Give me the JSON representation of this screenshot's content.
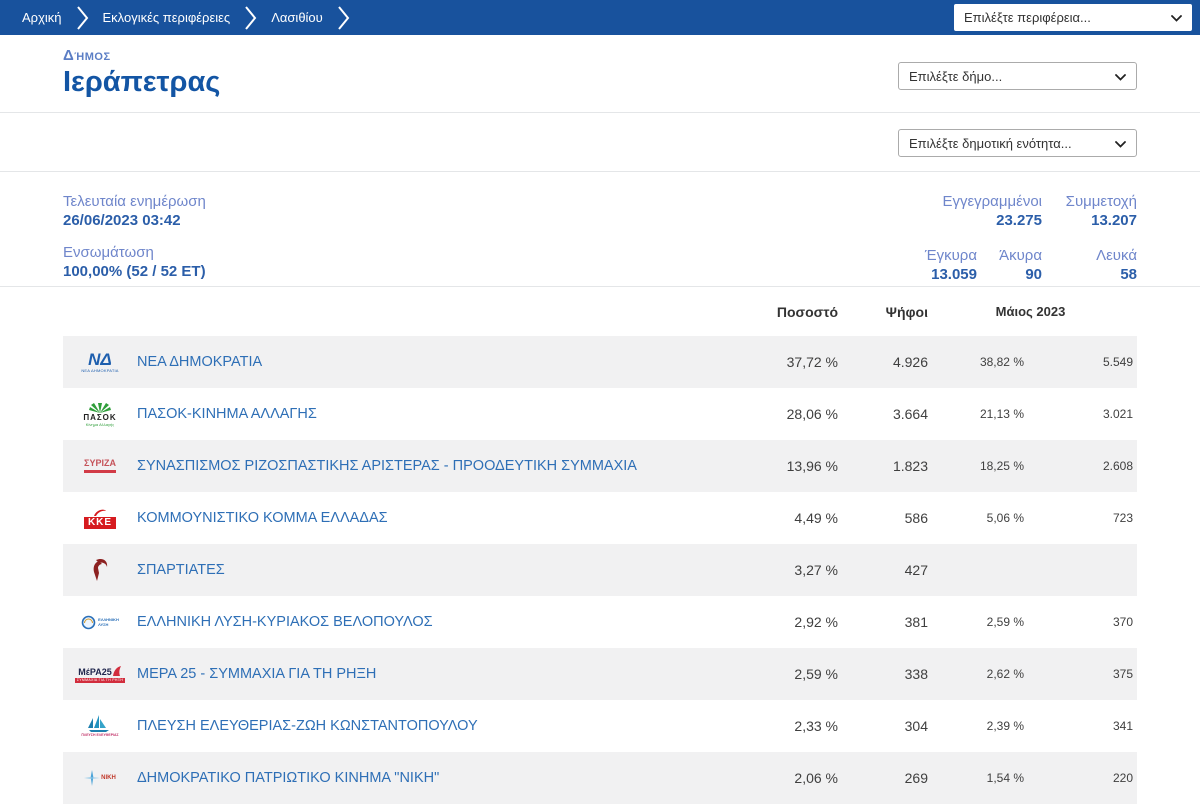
{
  "breadcrumb": {
    "items": [
      "Αρχική",
      "Εκλογικές περιφέρειες",
      "Λασιθίου"
    ]
  },
  "region_select": {
    "value": "Επιλέξτε περιφέρεια..."
  },
  "municipality_select": {
    "value": "Επιλέξτε δήμο..."
  },
  "unit_select": {
    "value": "Επιλέξτε δημοτική ενότητα..."
  },
  "page": {
    "subtitle": "Δήμος",
    "title": "Ιεράπετρας"
  },
  "stats": {
    "last_update_label": "Τελευταία ενημέρωση",
    "last_update_value": "26/06/2023 03:42",
    "integration_label": "Ενσωμάτωση",
    "integration_value": "100,00% (52 / 52 ΕΤ)",
    "registered_label": "Εγγεγραμμένοι",
    "registered_value": "23.275",
    "turnout_label": "Συμμετοχή",
    "turnout_value": "13.207",
    "valid_label": "Έγκυρα",
    "valid_value": "13.059",
    "invalid_label": "Άκυρα",
    "invalid_value": "90",
    "blank_label": "Λευκά",
    "blank_value": "58"
  },
  "results_table": {
    "headers": {
      "percent": "Ποσοστό",
      "votes": "Ψήφοι",
      "previous": "Μάιος 2023"
    },
    "rows": [
      {
        "logo": "nea-dimokratia",
        "party": "ΝΕΑ ΔΗΜΟΚΡΑΤΙΑ",
        "percent": "37,72 %",
        "votes": "4.926",
        "prev_percent": "38,82 %",
        "prev_votes": "5.549"
      },
      {
        "logo": "pasok",
        "party": "ΠΑΣΟΚ-ΚΙΝΗΜΑ ΑΛΛΑΓΗΣ",
        "percent": "28,06 %",
        "votes": "3.664",
        "prev_percent": "21,13 %",
        "prev_votes": "3.021"
      },
      {
        "logo": "syriza",
        "party": "ΣΥΝΑΣΠΙΣΜΟΣ ΡΙΖΟΣΠΑΣΤΙΚΗΣ ΑΡΙΣΤΕΡΑΣ - ΠΡΟΟΔΕΥΤΙΚΗ ΣΥΜΜΑΧΙΑ",
        "percent": "13,96 %",
        "votes": "1.823",
        "prev_percent": "18,25 %",
        "prev_votes": "2.608"
      },
      {
        "logo": "kke",
        "party": "ΚΟΜΜΟΥΝΙΣΤΙΚΟ ΚΟΜΜΑ ΕΛΛΑΔΑΣ",
        "percent": "4,49 %",
        "votes": "586",
        "prev_percent": "5,06 %",
        "prev_votes": "723"
      },
      {
        "logo": "spartiates",
        "party": "ΣΠΑΡΤΙΑΤΕΣ",
        "percent": "3,27 %",
        "votes": "427",
        "prev_percent": "",
        "prev_votes": ""
      },
      {
        "logo": "elliniki-lysi",
        "party": "ΕΛΛΗΝΙΚΗ ΛΥΣΗ-ΚΥΡΙΑΚΟΣ ΒΕΛΟΠΟΥΛΟΣ",
        "percent": "2,92 %",
        "votes": "381",
        "prev_percent": "2,59 %",
        "prev_votes": "370"
      },
      {
        "logo": "mera25",
        "party": "ΜΕΡΑ 25 - ΣΥΜΜΑΧΙΑ ΓΙΑ ΤΗ ΡΗΞΗ",
        "percent": "2,59 %",
        "votes": "338",
        "prev_percent": "2,62 %",
        "prev_votes": "375"
      },
      {
        "logo": "plefsi-eleftherias",
        "party": "ΠΛΕΥΣΗ ΕΛΕΥΘΕΡΙΑΣ-ΖΩΗ ΚΩΝΣΤΑΝΤΟΠΟΥΛΟΥ",
        "percent": "2,33 %",
        "votes": "304",
        "prev_percent": "2,39 %",
        "prev_votes": "341"
      },
      {
        "logo": "niki",
        "party": "ΔΗΜΟΚΡΑΤΙΚΟ ΠΑΤΡΙΩΤΙΚΟ ΚΙΝΗΜΑ \"ΝΙΚΗ\"",
        "percent": "2,06 %",
        "votes": "269",
        "prev_percent": "1,54 %",
        "prev_votes": "220"
      }
    ]
  },
  "colors": {
    "topbar_blue": "#18529d",
    "title_blue": "#1355a4",
    "label_blue": "#6f86cb",
    "value_blue": "#2b5ea9",
    "link_blue": "#2e6fb6",
    "row_gray": "#f1f1f2"
  }
}
